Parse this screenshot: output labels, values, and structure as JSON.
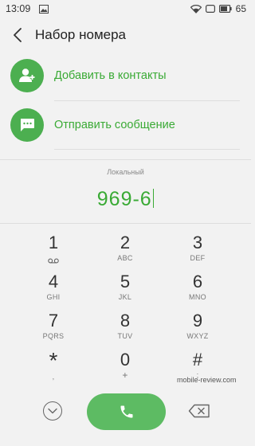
{
  "status": {
    "time": "13:09",
    "battery": "65"
  },
  "header": {
    "title": "Набор номера"
  },
  "actions": [
    {
      "label": "Добавить в контакты",
      "icon": "add-person-icon"
    },
    {
      "label": "Отправить сообщение",
      "icon": "chat-bubble-icon"
    }
  ],
  "dial": {
    "type_label": "Локальный",
    "number": "969-6"
  },
  "keypad": [
    {
      "digit": "1",
      "letters": "",
      "icon": "voicemail-icon"
    },
    {
      "digit": "2",
      "letters": "ABC"
    },
    {
      "digit": "3",
      "letters": "DEF"
    },
    {
      "digit": "4",
      "letters": "GHI"
    },
    {
      "digit": "5",
      "letters": "JKL"
    },
    {
      "digit": "6",
      "letters": "MNO"
    },
    {
      "digit": "7",
      "letters": "PQRS"
    },
    {
      "digit": "8",
      "letters": "TUV"
    },
    {
      "digit": "9",
      "letters": "WXYZ"
    },
    {
      "digit": "*",
      "letters": ","
    },
    {
      "digit": "0",
      "letters": "+"
    },
    {
      "digit": "#",
      "letters": ";"
    }
  ],
  "watermark": "mobile-review.com",
  "colors": {
    "accent": "#3aaa35",
    "call_button": "#5dbb63"
  }
}
